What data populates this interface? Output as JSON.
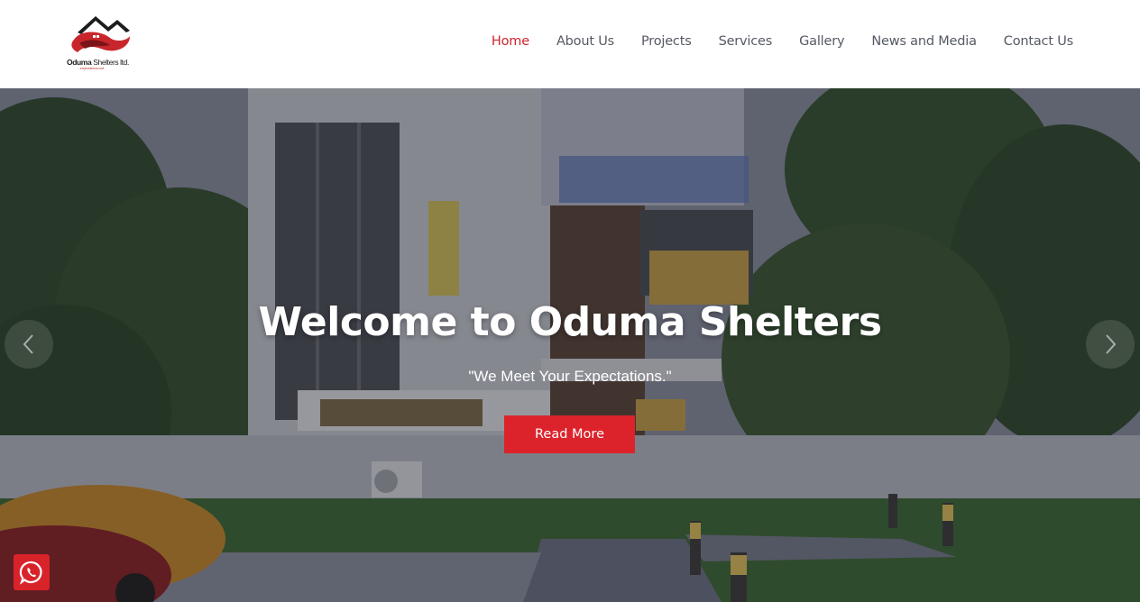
{
  "brand": {
    "name_bold": "Oduma",
    "name_rest": " Shelters ltd.",
    "tagline": "...expectations met"
  },
  "nav": {
    "items": [
      {
        "label": "Home",
        "active": true
      },
      {
        "label": "About Us"
      },
      {
        "label": "Projects"
      },
      {
        "label": "Services"
      },
      {
        "label": "Gallery"
      },
      {
        "label": "News and Media"
      },
      {
        "label": "Contact Us"
      }
    ]
  },
  "hero": {
    "title": "Welcome to Oduma Shelters",
    "subtitle": "\"We Meet Your Expectations.\"",
    "cta_label": "Read More"
  },
  "icons": {
    "prev": "chevron-left-icon",
    "next": "chevron-right-icon",
    "chat": "whatsapp-icon"
  },
  "colors": {
    "accent": "#dc232b",
    "nav_text": "#555a63"
  }
}
